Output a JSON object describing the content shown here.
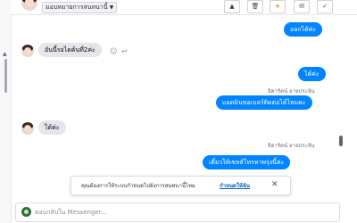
{
  "header": {
    "assignee_label": "มอบหมายการสนทนานี้",
    "toolbar": [
      "warning-icon",
      "trash-icon",
      "star-icon",
      "mail-icon",
      "check-icon"
    ],
    "glyphs": {
      "warning": "▲",
      "trash": "🗑",
      "star": "★",
      "mail": "✉",
      "check": "✓"
    }
  },
  "messages": [
    {
      "direction": "out",
      "text": "ออกได้ค่ะ"
    },
    {
      "direction": "in",
      "text": "อันนี้รอไดค้นที่2ค่ะ"
    },
    {
      "direction": "out",
      "text": "ได้ค่ะ"
    },
    {
      "direction": "out",
      "sender": "ธิดารัตน์ อาจประจัน",
      "text": "แอดมินขอเบอร์ติดต่อได้ไหมคะ"
    },
    {
      "direction": "in",
      "text": "ได้ค่ะ"
    },
    {
      "direction": "out",
      "sender": "ธิดารัตน์ อาจประจัน",
      "text": "เดี๋ยวให้เซลส์โทรหาพรุ่งนี้ค่ะ"
    }
  ],
  "toast": {
    "text": "คุณต้องการให้ระบบกำหนดไปยังการสนทนานี้ไหม",
    "link": "กำหนดให้ฉัน",
    "close": "✕"
  },
  "composer": {
    "placeholder": "ตอบกลับใน Messenger..."
  },
  "colors": {
    "outgoing_bubble": "#0084ff",
    "incoming_bubble": "#e4e6eb",
    "link": "#0a66c2"
  }
}
